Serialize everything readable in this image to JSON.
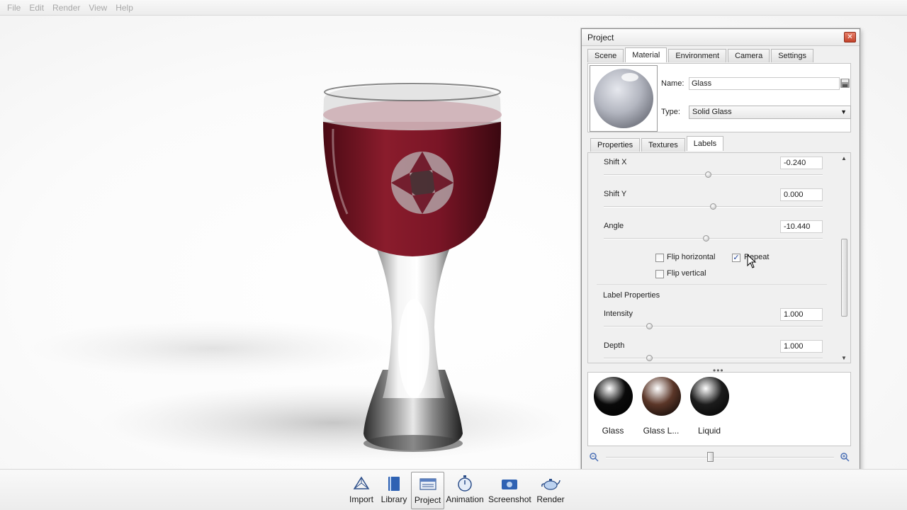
{
  "menu": [
    "File",
    "Edit",
    "Render",
    "View",
    "Help"
  ],
  "panel": {
    "title": "Project",
    "tabs": [
      "Scene",
      "Material",
      "Environment",
      "Camera",
      "Settings"
    ],
    "active_tab": "Material",
    "name_label": "Name:",
    "name_value": "Glass",
    "type_label": "Type:",
    "type_value": "Solid Glass",
    "subtabs": [
      "Properties",
      "Textures",
      "Labels"
    ],
    "active_subtab": "Labels",
    "labels": {
      "shift_x": {
        "label": "Shift X",
        "value": "-0.240",
        "position": 0.48
      },
      "shift_y": {
        "label": "Shift Y",
        "value": "0.000",
        "position": 0.5
      },
      "angle": {
        "label": "Angle",
        "value": "-10.440",
        "position": 0.47
      },
      "flip_horizontal": {
        "label": "Flip horizontal",
        "checked": false
      },
      "flip_vertical": {
        "label": "Flip vertical",
        "checked": false
      },
      "repeat": {
        "label": "Repeat",
        "checked": true
      },
      "section_title": "Label Properties",
      "intensity": {
        "label": "Intensity",
        "value": "1.000",
        "position": 0.21
      },
      "depth": {
        "label": "Depth",
        "value": "1.000",
        "position": 0.21
      }
    },
    "library": [
      {
        "label": "Glass",
        "color": "#0a0a0a"
      },
      {
        "label": "Glass L...",
        "color": "#5b3628"
      },
      {
        "label": "Liquid",
        "color": "#1c1c1c"
      }
    ],
    "zoom_level": 0.46
  },
  "toolbar": {
    "items": [
      "Import",
      "Library",
      "Project",
      "Animation",
      "Screenshot",
      "Render"
    ],
    "active": "Project"
  },
  "colors": {
    "wine": "#6e0f1e",
    "close": "#c3422a"
  }
}
